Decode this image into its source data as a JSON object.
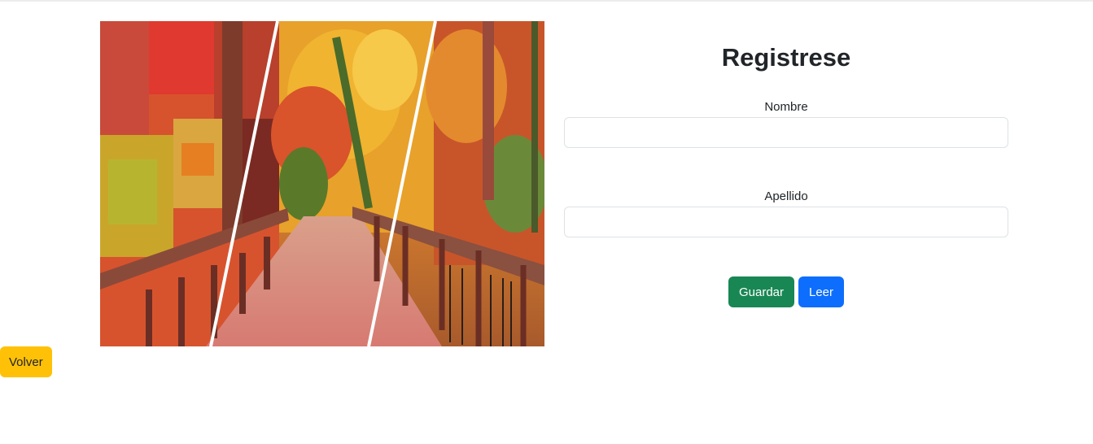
{
  "page": {
    "image_alt": "autumn-forest-bridge-image"
  },
  "form": {
    "title": "Registrese",
    "nombre_label": "Nombre",
    "nombre_value": "",
    "apellido_label": "Apellido",
    "apellido_value": "",
    "save_label": "Guardar",
    "read_label": "Leer"
  },
  "back_button": {
    "label": "Volver"
  },
  "colors": {
    "save": "#198754",
    "read": "#0d6efd",
    "back": "#ffc107"
  }
}
